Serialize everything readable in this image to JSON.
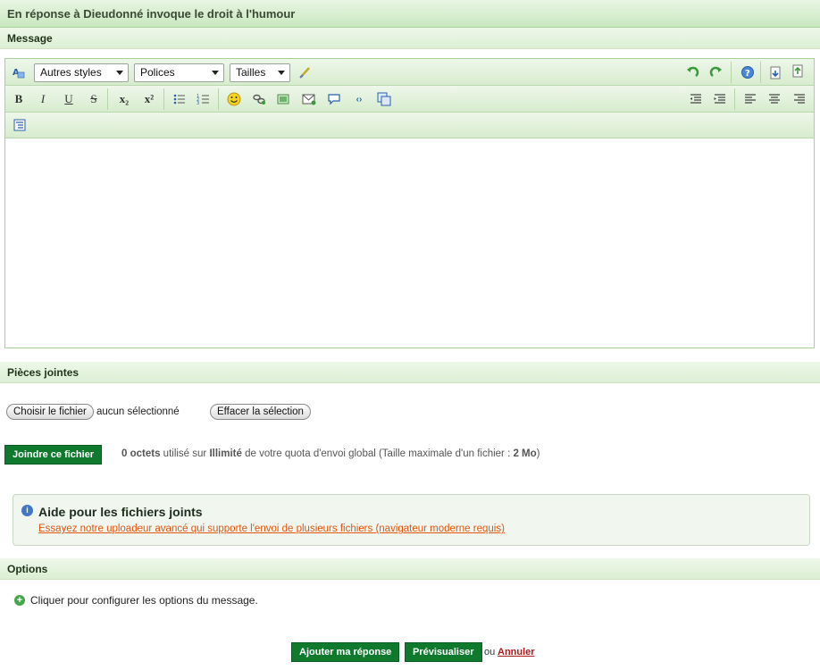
{
  "header": {
    "title": "En réponse à Dieudonné invoque le droit à l'humour"
  },
  "message_section": {
    "label": "Message"
  },
  "toolbar": {
    "styles_dropdown": "Autres styles",
    "fonts_dropdown": "Polices",
    "sizes_dropdown": "Tailles",
    "bold": "B",
    "italic": "I",
    "underline": "U",
    "strike": "S",
    "subscript": "x₂",
    "superscript": "x²"
  },
  "attachments": {
    "label": "Pièces jointes",
    "choose_button": "Choisir le fichier",
    "no_file_text": "aucun sélectionné",
    "clear_button": "Effacer la sélection",
    "attach_button": "Joindre ce fichier",
    "quota": {
      "used": "0 octets",
      "used_on": "utilisé sur",
      "limit": "Illimité",
      "rest": "de votre quota d'envoi global (Taille maximale d'un fichier :",
      "max_size": "2 Mo",
      "close_paren": ")"
    },
    "help": {
      "title": "Aide pour les fichiers joints",
      "link": "Essayez notre uploadeur avancé qui supporte l'envoi de plusieurs fichiers (navigateur moderne requis)"
    }
  },
  "options": {
    "label": "Options",
    "configure_text": "Cliquer pour configurer les options du message."
  },
  "actions": {
    "submit": "Ajouter ma réponse",
    "preview": "Prévisualiser",
    "or": "ou",
    "cancel": "Annuler"
  },
  "colors": {
    "accent_green": "#0f7a2e",
    "header_green": "#c9e8bf",
    "link_orange": "#e2560e",
    "cancel_red": "#b0181e"
  }
}
